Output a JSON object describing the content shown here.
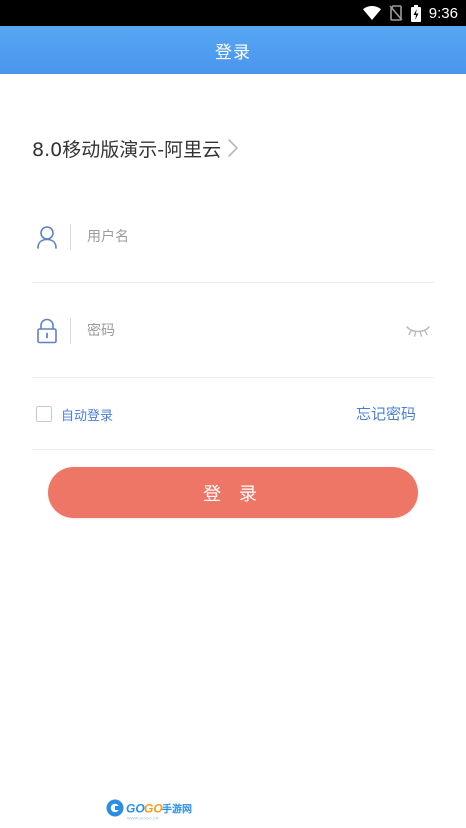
{
  "status_bar": {
    "time": "9:36",
    "icons": [
      "wifi-icon",
      "no-sim-icon",
      "battery-charging-icon"
    ]
  },
  "header": {
    "title": "登录"
  },
  "server_selector": {
    "name": "8.0移动版演示-阿里云",
    "icon": "chevron-right-icon"
  },
  "username_field": {
    "placeholder": "用户名",
    "value": "",
    "icon": "user-icon"
  },
  "password_field": {
    "placeholder": "密码",
    "value": "",
    "icon": "lock-icon",
    "toggle_icon": "eye-closed-icon"
  },
  "options": {
    "auto_login_label": "自动登录",
    "auto_login_checked": false,
    "forgot_password_label": "忘记密码"
  },
  "login_button": {
    "label": "登 录"
  },
  "watermark": {
    "text": "GOGO手游网"
  },
  "colors": {
    "header_blue": "#4a95ee",
    "accent_blue": "#4a7fd0",
    "button_coral": "#ee7666",
    "status_bar": "#000000"
  }
}
